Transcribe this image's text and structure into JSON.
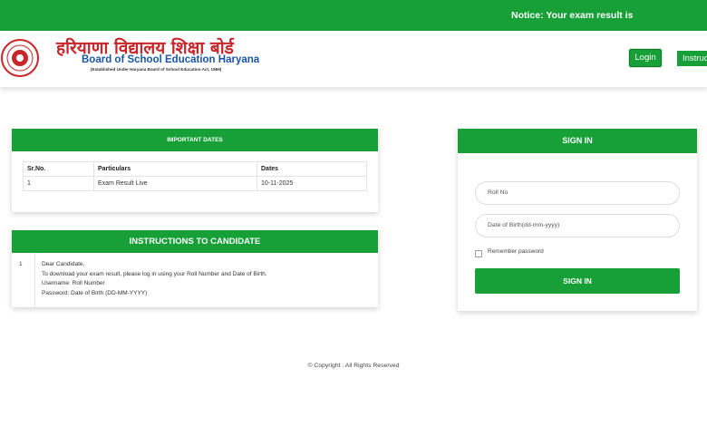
{
  "topbar": {
    "notice": "Notice: Your exam result is"
  },
  "header": {
    "title_hindi": "हरियाणा विद्यालय शिक्षा बोर्ड",
    "title_english": "Board of School Education Haryana",
    "established": "(Established Under Haryana Board of School Education Act, 1969)",
    "login_label": "Login",
    "instructions_label": "Instructions"
  },
  "important_dates": {
    "heading": "IMPORTANT DATES",
    "columns": [
      "Sr.No.",
      "Particulars",
      "Dates"
    ],
    "rows": [
      {
        "sr": "1",
        "particular": "Exam Result Live",
        "date": "10-11-2025"
      }
    ]
  },
  "instructions": {
    "heading": "INSTRUCTIONS TO CANDIDATE",
    "number": "1",
    "lines": [
      "Dear Candidate,",
      "To download your exam result, please log in using your Roll Number and Date of Birth.",
      "Username: Roll Number",
      "Password: Date of Birth (DD-MM-YYYY)"
    ]
  },
  "signin": {
    "heading": "SIGN IN",
    "roll_placeholder": "Roll No",
    "dob_placeholder": "Date of Birth(dd-mm-yyyy)",
    "remember_label": "Remember password",
    "button_label": "SIGN IN"
  },
  "footer": {
    "copyright": "© Copyright . All Rights Reserved"
  },
  "colors": {
    "primary_green": "#16a037",
    "hindi_red": "#c8262b",
    "english_blue": "#1a56a8"
  },
  "icons": {
    "logo": "board-seal-logo"
  }
}
